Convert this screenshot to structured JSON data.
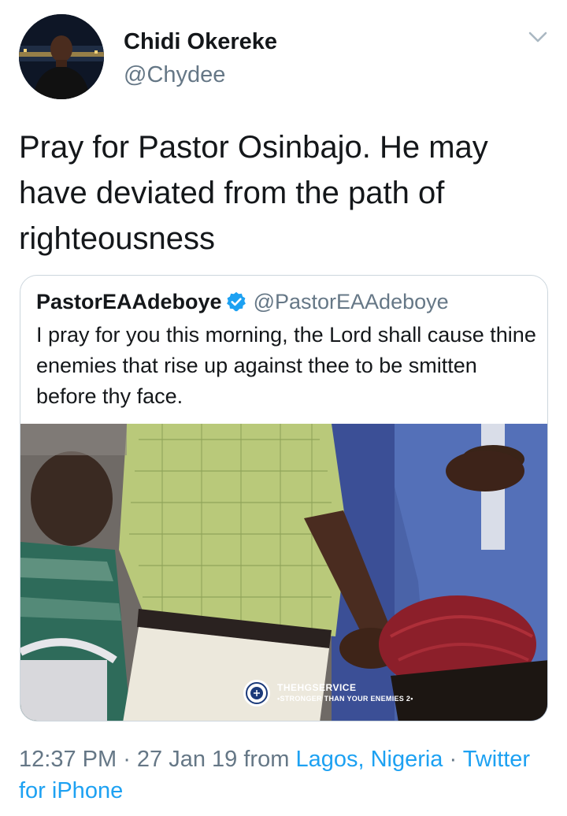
{
  "tweet": {
    "author_name": "Chidi Okereke",
    "author_handle": "@Chydee",
    "text": "Pray for Pastor Osinbajo. He may have deviated from the path of righteousness",
    "menu_icon": "chevron-down-icon"
  },
  "quoted_tweet": {
    "author_name": "PastorEAAdeboye",
    "verified_icon": "verified-badge-icon",
    "author_handle": "@PastorEAAdeboye",
    "text": "I pray for you this morning, the Lord shall cause thine enemies that rise up against thee to be smitten before thy face.",
    "image_watermark": {
      "brand": "THEHGSERVICE",
      "tagline": "•STRONGER THAN YOUR ENEMIES 2•"
    }
  },
  "meta": {
    "time": "12:37 PM",
    "separator1": " · ",
    "date": "27 Jan 19",
    "from_label": " from ",
    "location": "Lagos, Nigeria",
    "separator2": " · ",
    "source": "Twitter for iPhone"
  },
  "colors": {
    "text_primary": "#14171a",
    "text_secondary": "#657786",
    "link": "#1da1f2",
    "border": "#ccd6dd"
  }
}
